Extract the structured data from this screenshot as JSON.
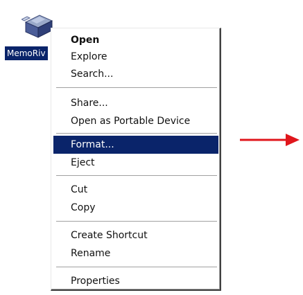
{
  "desktop": {
    "drive_label": "MemoRiv",
    "drive_icon": "usb-drive-icon"
  },
  "context_menu": {
    "items": [
      {
        "label": "Open",
        "bold": true
      },
      {
        "label": "Explore"
      },
      {
        "label": "Search..."
      },
      {
        "label": "Share..."
      },
      {
        "label": "Open as Portable Device"
      },
      {
        "label": "Format...",
        "highlighted": true
      },
      {
        "label": "Eject"
      },
      {
        "label": "Cut"
      },
      {
        "label": "Copy"
      },
      {
        "label": "Create Shortcut"
      },
      {
        "label": "Rename"
      },
      {
        "label": "Properties"
      }
    ]
  },
  "annotation": {
    "arrow_icon": "right-arrow-icon",
    "arrow_color": "#e0161c"
  },
  "colors": {
    "highlight": "#0a246a",
    "highlight_text": "#ffffff",
    "menu_background": "#ffffff"
  }
}
